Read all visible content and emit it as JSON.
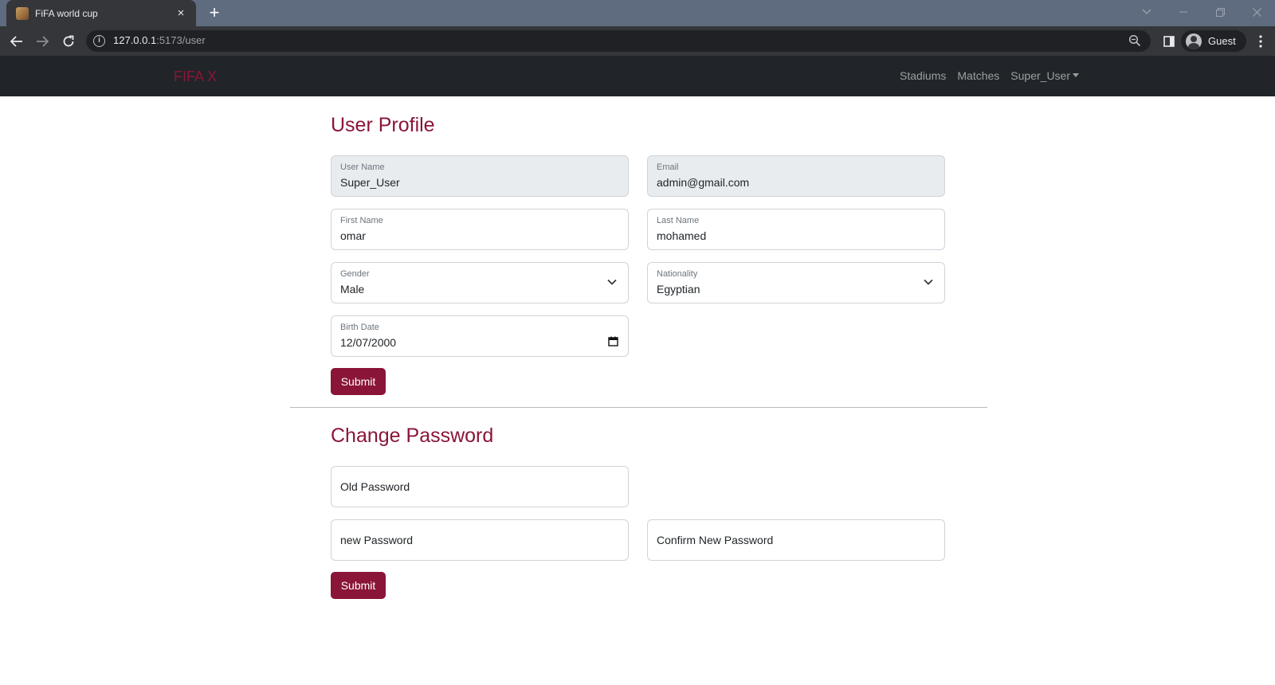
{
  "browser": {
    "tab_title": "FiFA world cup",
    "new_tab_symbol": "+",
    "close_symbol": "×",
    "url_host": "127.0.0.1",
    "url_path": ":5173/user",
    "info_symbol": "i",
    "profile_name": "Guest"
  },
  "navbar": {
    "brand": "FIFA X",
    "links": [
      "Stadiums",
      "Matches",
      "Super_User"
    ],
    "brand_color": "#8a1538",
    "bg_color": "#212529"
  },
  "profile_section": {
    "title": "User Profile",
    "username": {
      "label": "User Name",
      "value": "Super_User"
    },
    "email": {
      "label": "Email",
      "value": "admin@gmail.com"
    },
    "first_name": {
      "label": "First Name",
      "value": "omar"
    },
    "last_name": {
      "label": "Last Name",
      "value": "mohamed"
    },
    "gender": {
      "label": "Gender",
      "value": "Male"
    },
    "nationality": {
      "label": "Nationality",
      "value": "Egyptian"
    },
    "birth_date": {
      "label": "Birth Date",
      "value": "12/07/2000"
    },
    "submit_label": "Submit"
  },
  "password_section": {
    "title": "Change Password",
    "old_placeholder": "Old Password",
    "new_placeholder": "new Password",
    "confirm_placeholder": "Confirm New Password",
    "submit_label": "Submit"
  },
  "accent_color": "#8a1538"
}
